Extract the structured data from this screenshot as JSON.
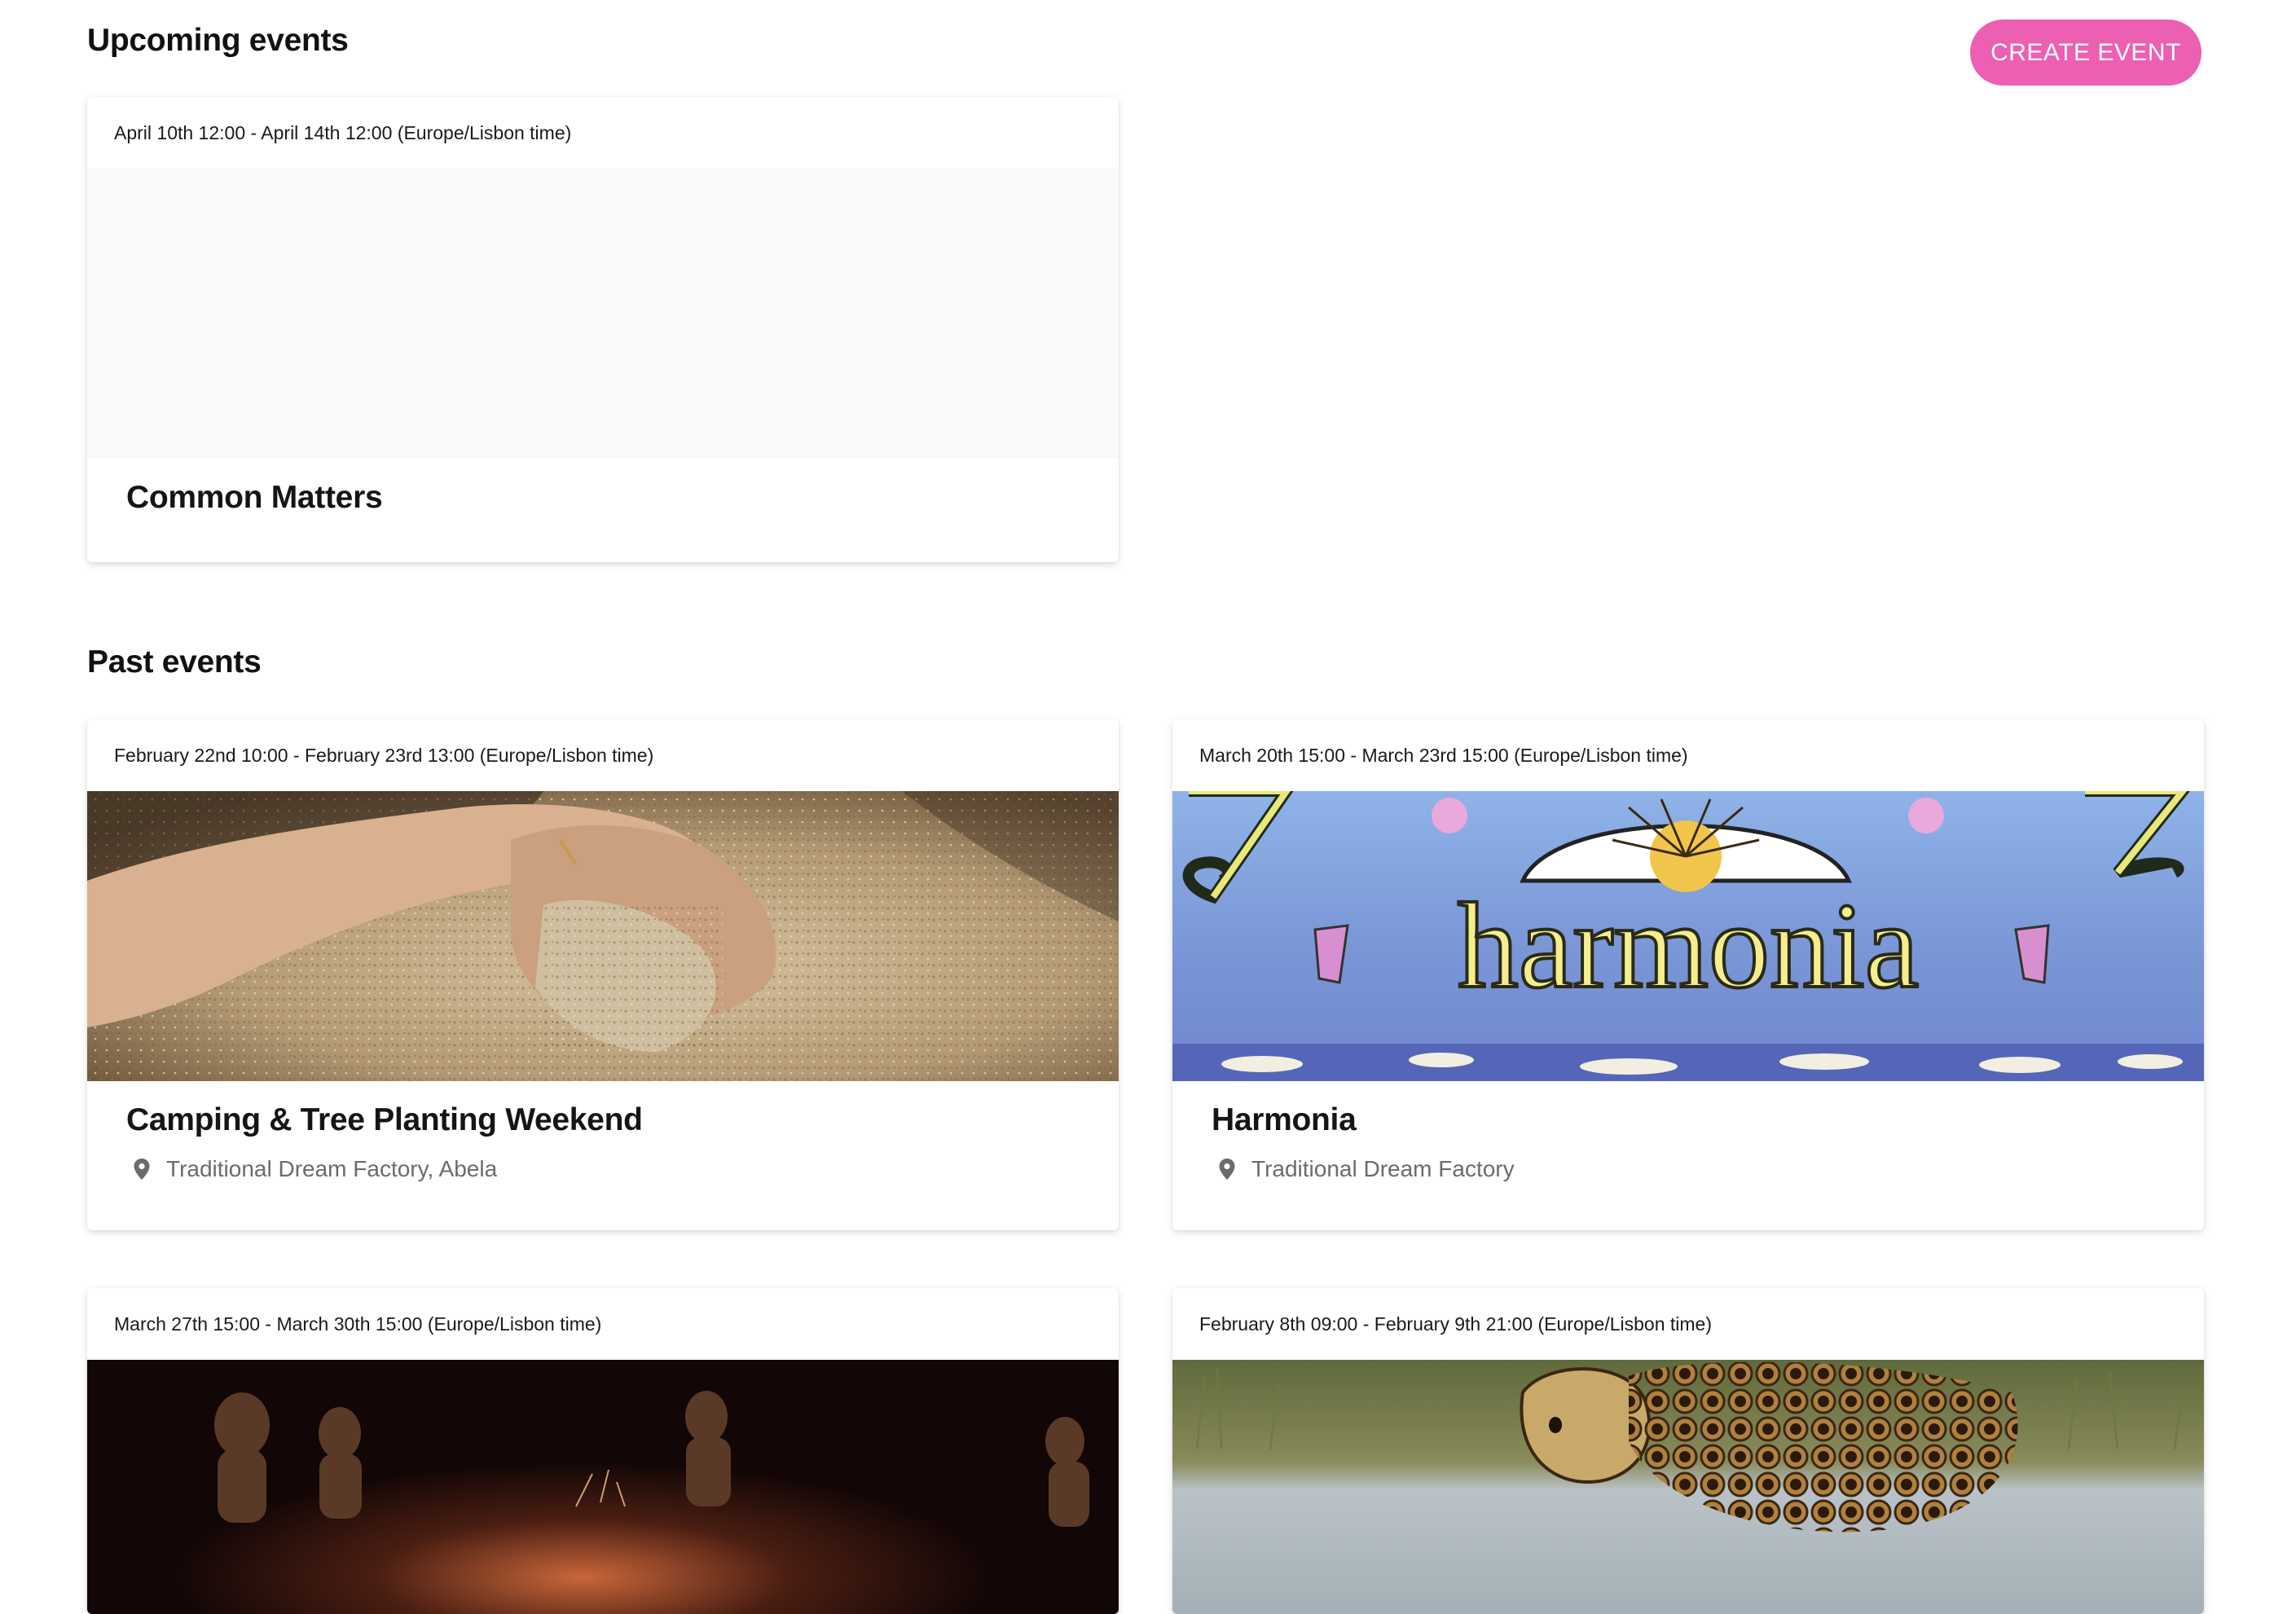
{
  "header": {
    "upcoming_title": "Upcoming events",
    "create_label": "CREATE EVENT",
    "past_title": "Past events"
  },
  "colors": {
    "accent": "#ec5fb2",
    "placeholder_bg": "#f8f9fa",
    "location_text": "#6b6b6b"
  },
  "upcoming": [
    {
      "date": "April 10th 12:00 - April 14th 12:00 (Europe/Lisbon time)",
      "title": "Common Matters",
      "image": "blank-placeholder"
    }
  ],
  "past": [
    {
      "date": "February 22nd 10:00 - February 23rd 13:00 (Europe/Lisbon time)",
      "title": "Camping & Tree Planting Weekend",
      "location": "Traditional Dream Factory, Abela",
      "image": "hands-holding-sand-photo"
    },
    {
      "date": "March 20th 15:00 - March 23rd 15:00 (Europe/Lisbon time)",
      "title": "Harmonia",
      "location": "Traditional Dream Factory",
      "image": "harmonia-poster",
      "image_text": "harmonia"
    },
    {
      "date": "March 27th 15:00 - March 30th 15:00 (Europe/Lisbon time)",
      "title": "",
      "image": "campfire-night-photo"
    },
    {
      "date": "February 8th 09:00 - February 9th 21:00 (Europe/Lisbon time)",
      "title": "",
      "image": "sheep-sculpture-lake-photo"
    }
  ]
}
